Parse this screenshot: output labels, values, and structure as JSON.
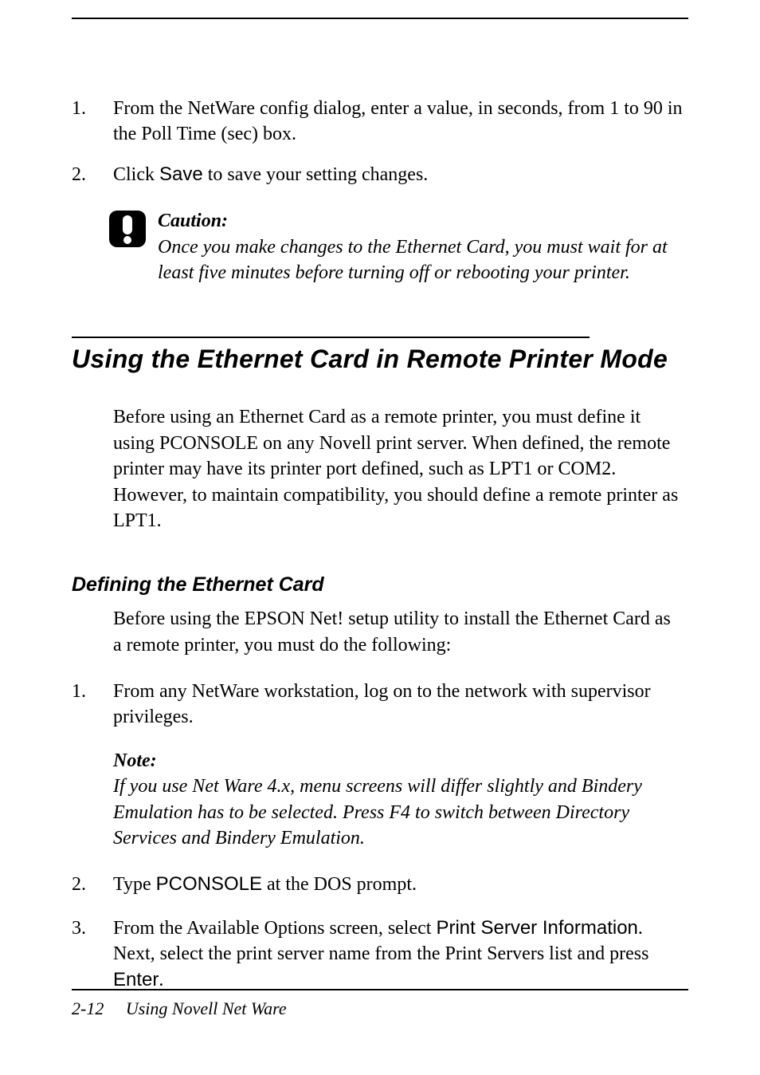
{
  "steps_top": {
    "s1_num": "1.",
    "s1_text": "From the NetWare config dialog, enter a value, in seconds, from 1 to 90 in the Poll Time (sec) box.",
    "s2_num": "2.",
    "s2_pre": "Click ",
    "s2_btn": "Save",
    "s2_post": " to save your setting changes."
  },
  "caution": {
    "label": "Caution:",
    "text": "Once you make changes to the Ethernet Card, you must wait for at least five minutes before turning off or rebooting your printer."
  },
  "section": {
    "title": "Using the Ethernet Card in Remote Printer Mode",
    "para": "Before using an Ethernet Card as a remote printer, you must define it using PCONSOLE on any Novell print server. When defined, the remote printer may have its printer port defined, such as LPT1 or COM2. However, to maintain compatibility, you should define a remote printer as LPT1."
  },
  "sub": {
    "heading": "Defining the Ethernet Card",
    "para": "Before using the EPSON Net! setup utility to install the Ethernet Card as a remote printer, you must do the following:"
  },
  "def_steps": {
    "s1_num": "1.",
    "s1_text": "From any NetWare workstation, log on to the network with supervisor privileges.",
    "s2_num": "2.",
    "s2_pre": "Type ",
    "s2_cmd": "PCONSOLE",
    "s2_post": " at the DOS prompt.",
    "s3_num": "3.",
    "s3_pre": "From the Available Options screen, select ",
    "s3_opt": "Print Server Information",
    "s3_mid": ". Next, select the print server name from the Print Servers list and press ",
    "s3_key": "Enter",
    "s3_end": "."
  },
  "note": {
    "label": "Note:",
    "text": "If you use Net Ware 4.x, menu screens will differ slightly and Bindery Emulation has to be selected. Press F4 to switch between Directory Services and Bindery Emulation."
  },
  "footer": {
    "page": "2-12",
    "chapter": "Using Novell Net Ware"
  }
}
